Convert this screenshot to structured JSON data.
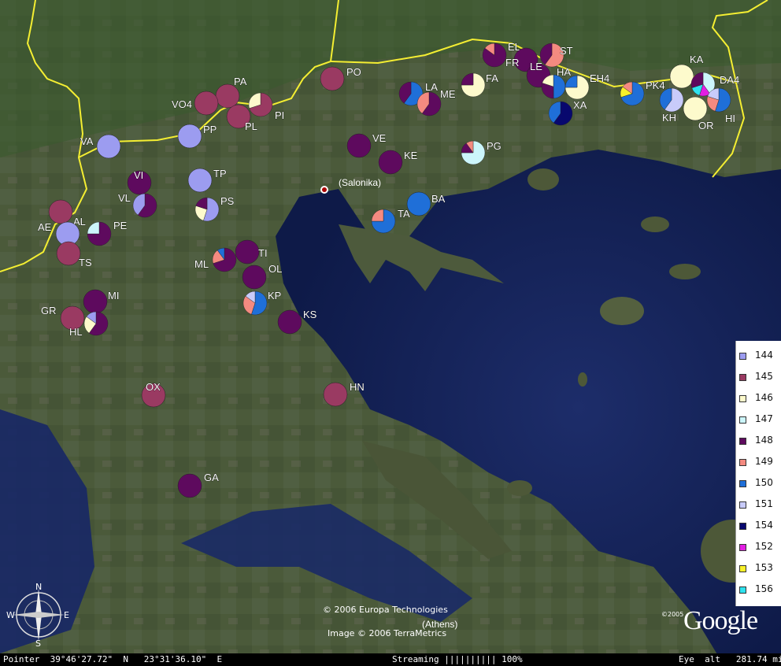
{
  "map": {
    "cities": [
      {
        "label": "(Salonika)"
      },
      {
        "label": "(Athens)"
      }
    ],
    "border_color": "#f4ee32",
    "sites": [
      {
        "label": "PA",
        "slices": [
          {
            "h": "145",
            "v": 1
          }
        ]
      },
      {
        "label": "PO",
        "slices": [
          {
            "h": "145",
            "v": 1
          }
        ]
      },
      {
        "label": "VO4",
        "slices": [
          {
            "h": "145",
            "v": 1
          }
        ]
      },
      {
        "label": "PI",
        "slices": [
          {
            "h": "145",
            "v": 0.7
          },
          {
            "h": "146",
            "v": 0.3
          }
        ]
      },
      {
        "label": "PL",
        "slices": [
          {
            "h": "145",
            "v": 1
          }
        ]
      },
      {
        "label": "PP",
        "slices": [
          {
            "h": "144",
            "v": 1
          }
        ]
      },
      {
        "label": "VA",
        "slices": [
          {
            "h": "144",
            "v": 1
          }
        ]
      },
      {
        "label": "TP",
        "slices": [
          {
            "h": "144",
            "v": 1
          }
        ]
      },
      {
        "label": "PS",
        "slices": [
          {
            "h": "144",
            "v": 0.55
          },
          {
            "h": "146",
            "v": 0.25
          },
          {
            "h": "148",
            "v": 0.2
          }
        ]
      },
      {
        "label": "VI",
        "slices": [
          {
            "h": "148",
            "v": 1
          }
        ]
      },
      {
        "label": "VL",
        "slices": [
          {
            "h": "148",
            "v": 0.6
          },
          {
            "h": "144",
            "v": 0.4
          }
        ]
      },
      {
        "label": "AL",
        "slices": [
          {
            "h": "145",
            "v": 1
          }
        ]
      },
      {
        "label": "AE",
        "slices": [
          {
            "h": "144",
            "v": 1
          }
        ]
      },
      {
        "label": "PE",
        "slices": [
          {
            "h": "148",
            "v": 0.75
          },
          {
            "h": "147",
            "v": 0.25
          }
        ]
      },
      {
        "label": "TS",
        "slices": [
          {
            "h": "145",
            "v": 1
          }
        ]
      },
      {
        "label": "ML",
        "slices": [
          {
            "h": "148",
            "v": 0.7
          },
          {
            "h": "149",
            "v": 0.2
          },
          {
            "h": "150",
            "v": 0.1
          }
        ]
      },
      {
        "label": "TI",
        "slices": [
          {
            "h": "148",
            "v": 1
          }
        ]
      },
      {
        "label": "OL",
        "slices": [
          {
            "h": "148",
            "v": 1
          }
        ]
      },
      {
        "label": "KP",
        "slices": [
          {
            "h": "150",
            "v": 0.55
          },
          {
            "h": "149",
            "v": 0.3
          },
          {
            "h": "151",
            "v": 0.15
          }
        ]
      },
      {
        "label": "KS",
        "slices": [
          {
            "h": "148",
            "v": 1
          }
        ]
      },
      {
        "label": "MI",
        "slices": [
          {
            "h": "148",
            "v": 1
          }
        ]
      },
      {
        "label": "GR",
        "slices": [
          {
            "h": "145",
            "v": 1
          }
        ]
      },
      {
        "label": "HL",
        "slices": [
          {
            "h": "148",
            "v": 0.6
          },
          {
            "h": "146",
            "v": 0.25
          },
          {
            "h": "144",
            "v": 0.15
          }
        ]
      },
      {
        "label": "OX",
        "slices": [
          {
            "h": "145",
            "v": 1
          }
        ]
      },
      {
        "label": "GA",
        "slices": [
          {
            "h": "148",
            "v": 1
          }
        ]
      },
      {
        "label": "HN",
        "slices": [
          {
            "h": "145",
            "v": 1
          }
        ]
      },
      {
        "label": "VE",
        "slices": [
          {
            "h": "148",
            "v": 1
          }
        ]
      },
      {
        "label": "KE",
        "slices": [
          {
            "h": "148",
            "v": 1
          }
        ]
      },
      {
        "label": "BA",
        "slices": [
          {
            "h": "150",
            "v": 1
          }
        ]
      },
      {
        "label": "TA",
        "slices": [
          {
            "h": "150",
            "v": 0.75
          },
          {
            "h": "149",
            "v": 0.25
          }
        ]
      },
      {
        "label": "PG",
        "slices": [
          {
            "h": "147",
            "v": 0.75
          },
          {
            "h": "148",
            "v": 0.15
          },
          {
            "h": "149",
            "v": 0.1
          }
        ]
      },
      {
        "label": "LA",
        "slices": [
          {
            "h": "150",
            "v": 0.6
          },
          {
            "h": "148",
            "v": 0.4
          }
        ]
      },
      {
        "label": "ME",
        "slices": [
          {
            "h": "148",
            "v": 0.6
          },
          {
            "h": "149",
            "v": 0.4
          }
        ]
      },
      {
        "label": "FA",
        "slices": [
          {
            "h": "146",
            "v": 0.75
          },
          {
            "h": "148",
            "v": 0.25
          }
        ]
      },
      {
        "label": "EL",
        "slices": [
          {
            "h": "148",
            "v": 0.85
          },
          {
            "h": "149",
            "v": 0.15
          }
        ]
      },
      {
        "label": "FR",
        "slices": [
          {
            "h": "148",
            "v": 1
          }
        ]
      },
      {
        "label": "ST",
        "slices": [
          {
            "h": "149",
            "v": 0.6
          },
          {
            "h": "148",
            "v": 0.4
          }
        ]
      },
      {
        "label": "LE",
        "slices": [
          {
            "h": "148",
            "v": 1
          }
        ]
      },
      {
        "label": "HA",
        "slices": [
          {
            "h": "150",
            "v": 0.5
          },
          {
            "h": "148",
            "v": 0.3
          },
          {
            "h": "146",
            "v": 0.2
          }
        ]
      },
      {
        "label": "EH4",
        "slices": [
          {
            "h": "146",
            "v": 0.75
          },
          {
            "h": "150",
            "v": 0.25
          }
        ]
      },
      {
        "label": "XA",
        "slices": [
          {
            "h": "154",
            "v": 0.6
          },
          {
            "h": "150",
            "v": 0.4
          }
        ]
      },
      {
        "label": "PK4",
        "slices": [
          {
            "h": "150",
            "v": 0.7
          },
          {
            "h": "153",
            "v": 0.15
          },
          {
            "h": "149",
            "v": 0.15
          }
        ]
      },
      {
        "label": "KA",
        "slices": [
          {
            "h": "146",
            "v": 1
          }
        ]
      },
      {
        "label": "DA4",
        "slices": [
          {
            "h": "147",
            "v": 0.4
          },
          {
            "h": "152",
            "v": 0.15
          },
          {
            "h": "156",
            "v": 0.15
          },
          {
            "h": "148",
            "v": 0.3
          }
        ]
      },
      {
        "label": "KH",
        "slices": [
          {
            "h": "151",
            "v": 0.6
          },
          {
            "h": "150",
            "v": 0.4
          }
        ]
      },
      {
        "label": "OR",
        "slices": [
          {
            "h": "146",
            "v": 1
          }
        ]
      },
      {
        "label": "HI",
        "slices": [
          {
            "h": "150",
            "v": 0.55
          },
          {
            "h": "149",
            "v": 0.25
          },
          {
            "h": "151",
            "v": 0.2
          }
        ]
      }
    ]
  },
  "legend": {
    "items": [
      {
        "label": "144",
        "color": "#9c9cf0"
      },
      {
        "label": "145",
        "color": "#9a3a62"
      },
      {
        "label": "146",
        "color": "#fdfacc"
      },
      {
        "label": "147",
        "color": "#ccf6fb"
      },
      {
        "label": "148",
        "color": "#5e0a5e"
      },
      {
        "label": "149",
        "color": "#f48a80"
      },
      {
        "label": "150",
        "color": "#1f6fd8"
      },
      {
        "label": "151",
        "color": "#c8cbfa"
      },
      {
        "label": "154",
        "color": "#08086e"
      },
      {
        "label": "152",
        "color": "#e21ee2"
      },
      {
        "label": "153",
        "color": "#f8f02a"
      },
      {
        "label": "156",
        "color": "#2ee2ee"
      }
    ]
  },
  "credits": {
    "europa": "© 2006 Europa Technologies",
    "terrametrics": "Image © 2006 TerraMetrics",
    "google_year": "©2005",
    "google": "Google"
  },
  "status_bar": {
    "pointer": "Pointer  39°46'27.72\"  N   23°31'36.10\"  E",
    "streaming": "Streaming |||||||||| 100%",
    "eye_alt": "Eye  alt   281.74 mi"
  },
  "compass": {
    "n": "N",
    "s": "S",
    "e": "E",
    "w": "W"
  }
}
